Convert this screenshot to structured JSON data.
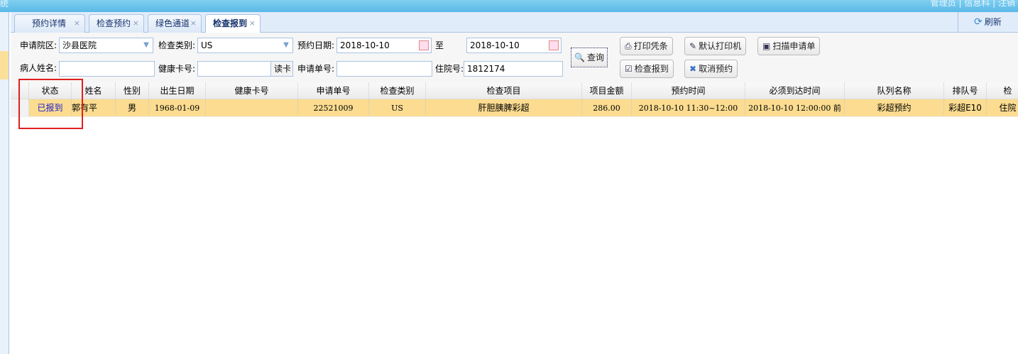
{
  "app": {
    "title_fragment": "统",
    "user_links": "管理员 | 信息科 | 注销"
  },
  "tabs": [
    {
      "label": "预约详情"
    },
    {
      "label": "检查预约"
    },
    {
      "label": "绿色通道"
    },
    {
      "label": "检查报到",
      "active": true
    }
  ],
  "toolbar": {
    "refresh_label": "刷新"
  },
  "form": {
    "campus_label": "申请院区:",
    "campus_value": "沙县医院",
    "exam_type_label": "检查类别:",
    "exam_type_value": "US",
    "appt_date_label": "预约日期:",
    "date_from": "2018-10-10",
    "to_label": "至",
    "date_to": "2018-10-10",
    "patient_name_label": "病人姓名:",
    "patient_name_value": "",
    "health_card_label": "健康卡号:",
    "health_card_value": "",
    "read_card_label": "读卡",
    "request_no_label": "申请单号:",
    "request_no_value": "",
    "inpatient_no_label": "住院号:",
    "inpatient_no_value": "1812174"
  },
  "buttons": {
    "query": "查询",
    "print_slip": "打印凭条",
    "default_printer": "默认打印机",
    "scan_request": "扫描申请单",
    "check_in": "检查报到",
    "cancel_appt": "取消预约"
  },
  "table": {
    "columns": [
      "状态",
      "姓名",
      "性别",
      "出生日期",
      "健康卡号",
      "申请单号",
      "检查类别",
      "检查项目",
      "项目金额",
      "预约时间",
      "必须到达时间",
      "队列名称",
      "排队号",
      "检"
    ],
    "rows": [
      [
        "已报到",
        "郭有平",
        "男",
        "1968-01-09",
        "",
        "22521009",
        "US",
        "肝胆胰脾彩超",
        "286.00",
        "2018-10-10 11:30~12:00",
        "2018-10-10 12:00:00 前",
        "彩超预约",
        "彩超E10",
        "住院"
      ]
    ]
  },
  "colors": {
    "status_text": "#1a1acc",
    "row_highlight": "#fbdc90",
    "annotation_box": "#e02020"
  }
}
